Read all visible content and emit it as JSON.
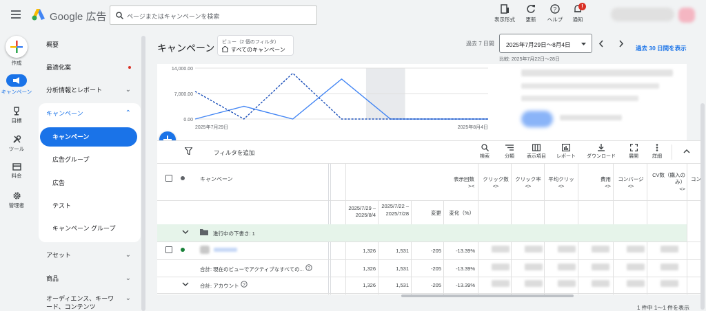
{
  "app": {
    "name": "Google 広告"
  },
  "search": {
    "placeholder": "ページまたはキャンペーンを検索"
  },
  "header_tools": [
    {
      "label": "表示形式",
      "icon": "display-format-icon"
    },
    {
      "label": "更新",
      "icon": "refresh-icon"
    },
    {
      "label": "ヘルプ",
      "icon": "help-icon"
    },
    {
      "label": "通知",
      "icon": "bell-icon",
      "badge": "!"
    }
  ],
  "rail": [
    {
      "label": "作成",
      "icon": "plus-icon"
    },
    {
      "label": "キャンペーン",
      "icon": "megaphone-icon",
      "active": true
    },
    {
      "label": "目標",
      "icon": "trophy-icon"
    },
    {
      "label": "ツール",
      "icon": "tools-icon"
    },
    {
      "label": "料金",
      "icon": "billing-card-icon"
    },
    {
      "label": "管理者",
      "icon": "gear-icon"
    }
  ],
  "nav": {
    "overview": "概要",
    "recommendations": "最適化案",
    "insights": "分析情報とレポート",
    "campaigns_group": "キャンペーン",
    "campaigns": "キャンペーン",
    "ad_groups": "広告グループ",
    "ads": "広告",
    "test": "テスト",
    "campaign_groups": "キャンペーン グループ",
    "assets": "アセット",
    "products": "商品",
    "audiences": "オーディエンス、キーワード、コンテンツ"
  },
  "page": {
    "title": "キャンペーン",
    "view_label": "ビュー（2 個のフィルタ）",
    "view_value": "すべてのキャンペーン",
    "range_label": "過去 7 日間",
    "range_value": "2025年7月29日～8月4日",
    "compare_text": "比較: 2025年7月22日～28日",
    "range_link": "過去 30 日間を表示"
  },
  "chart_data": {
    "type": "line",
    "x": [
      "2025年7月29日",
      "2025年7月30日",
      "2025年7月31日",
      "2025年8月1日",
      "2025年8月2日",
      "2025年8月3日",
      "2025年8月4日"
    ],
    "x_tick_labels": [
      "2025年7月29日",
      "2025年8月4日"
    ],
    "y_tick_labels": [
      "14,000.00",
      "7,000.00",
      "0.00"
    ],
    "ylim": [
      0,
      14000
    ],
    "grid": true,
    "shaded_category": "2025年8月2日",
    "series": [
      {
        "style": "solid",
        "color": "#4285f4",
        "values": [
          0,
          3500,
          0,
          11000,
          0,
          0,
          0
        ]
      },
      {
        "style": "dashed",
        "color": "#1a4fba",
        "values": [
          7600,
          0,
          12600,
          0,
          0,
          0,
          0
        ]
      }
    ]
  },
  "toolbar": {
    "filter_add": "フィルタを追加",
    "actions": [
      {
        "label": "検索",
        "icon": "search-icon"
      },
      {
        "label": "分類",
        "icon": "segment-icon"
      },
      {
        "label": "表示項目",
        "icon": "columns-icon"
      },
      {
        "label": "レポート",
        "icon": "report-icon"
      },
      {
        "label": "ダウンロード",
        "icon": "download-icon"
      },
      {
        "label": "展開",
        "icon": "expand-icon"
      },
      {
        "label": "詳細",
        "icon": "more-vert-icon"
      }
    ]
  },
  "table": {
    "headers": {
      "campaign": "キャンペーン",
      "impressions": "表示回数",
      "clicks": "クリック数",
      "ctr": "クリック率",
      "avg_cpc": "平均クリッ",
      "cost": "費用",
      "conversions": "コンバージ",
      "cv_count": "CV数（購入のみ）",
      "conv_cut": "コン"
    },
    "sub_headers": {
      "period_current": "2025/7/29 –2025/8/4",
      "period_prev": "2025/7/22 – 2025/7/28",
      "change": "変更",
      "change_pct": "変化（%）"
    },
    "draft_row": "進行中の下書き: 1",
    "rows": [
      {
        "type": "campaign",
        "current": "1,326",
        "prev": "1,531",
        "change": "-205",
        "pct": "-13.39%"
      },
      {
        "type": "total_view",
        "label": "合計: 現在のビューでアクティブなすべての...",
        "current": "1,326",
        "prev": "1,531",
        "change": "-205",
        "pct": "-13.39%"
      },
      {
        "type": "total_account",
        "label": "合計: アカウント",
        "current": "1,326",
        "prev": "1,531",
        "change": "-205",
        "pct": "-13.39%"
      }
    ],
    "pagination": "1 件中 1～1 件を表示"
  }
}
